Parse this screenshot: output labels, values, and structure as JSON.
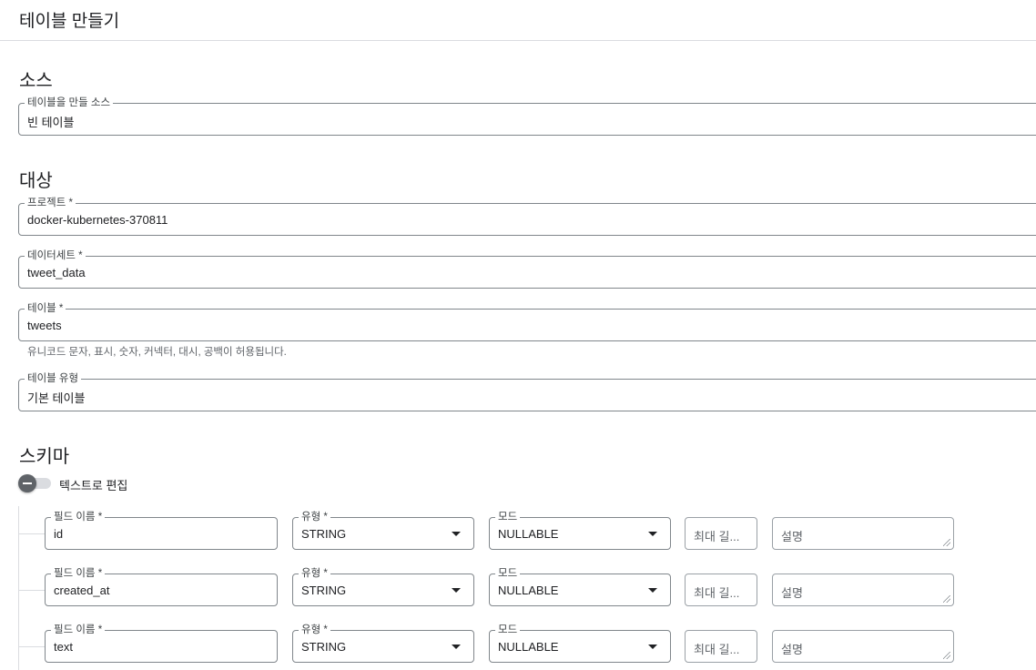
{
  "header": {
    "title": "테이블 만들기"
  },
  "source": {
    "section_title": "소스",
    "field_label": "테이블을 만들 소스",
    "field_value": "빈 테이블"
  },
  "destination": {
    "section_title": "대상",
    "project": {
      "label": "프로젝트 *",
      "value": "docker-kubernetes-370811"
    },
    "dataset": {
      "label": "데이터세트 *",
      "value": "tweet_data"
    },
    "table": {
      "label": "테이블 *",
      "value": "tweets",
      "hint": "유니코드 문자, 표시, 숫자, 커넥터, 대시, 공백이 허용됩니다."
    },
    "table_type": {
      "label": "테이블 유형",
      "value": "기본 테이블"
    }
  },
  "schema": {
    "section_title": "스키마",
    "edit_as_text_label": "텍스트로 편집",
    "edit_as_text_enabled": false,
    "fields": [
      {
        "name_label": "필드 이름 *",
        "name": "id",
        "type_label": "유형 *",
        "type": "STRING",
        "mode_label": "모드",
        "mode": "NULLABLE",
        "max_length_placeholder": "최대 길...",
        "description_placeholder": "설명"
      },
      {
        "name_label": "필드 이름 *",
        "name": "created_at",
        "type_label": "유형 *",
        "type": "STRING",
        "mode_label": "모드",
        "mode": "NULLABLE",
        "max_length_placeholder": "최대 길...",
        "description_placeholder": "설명"
      },
      {
        "name_label": "필드 이름 *",
        "name": "text",
        "type_label": "유형 *",
        "type": "STRING",
        "mode_label": "모드",
        "mode": "NULLABLE",
        "max_length_placeholder": "최대 길...",
        "description_placeholder": "설명"
      }
    ]
  }
}
